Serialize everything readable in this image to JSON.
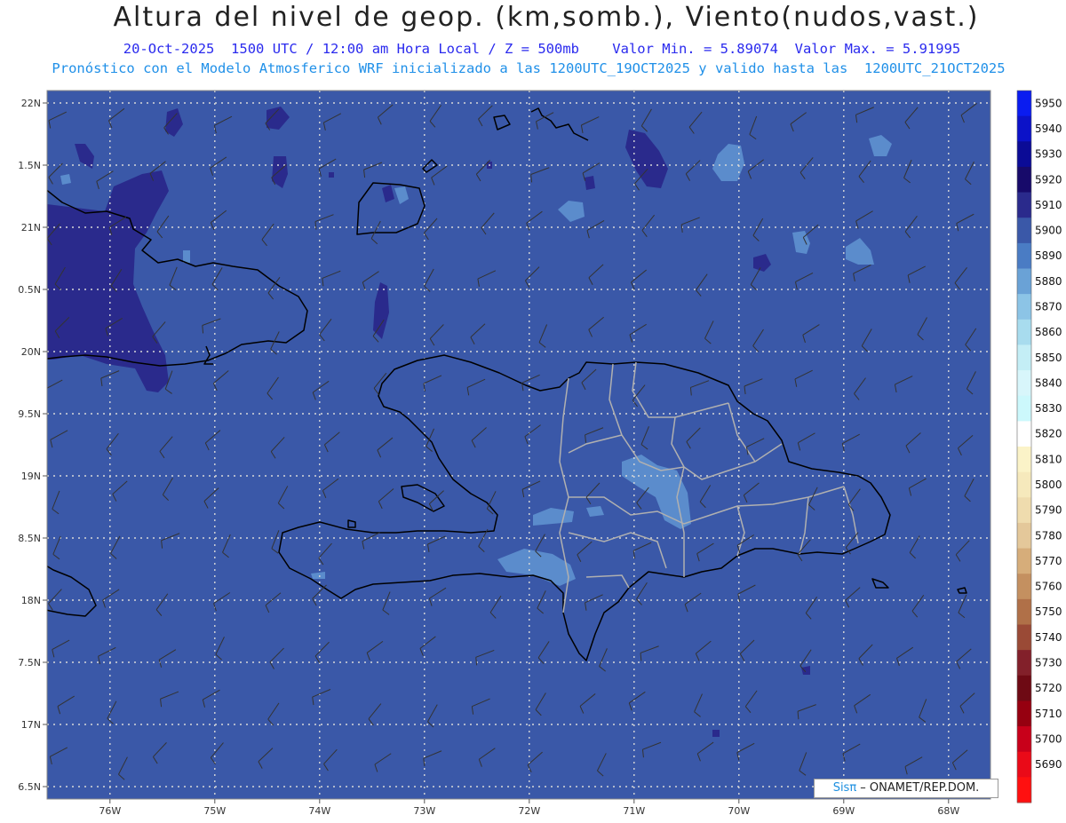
{
  "header": {
    "title": "Altura del nivel de geop. (km,somb.), Viento(nudos,vast.)",
    "line1": "20-Oct-2025  1500 UTC / 12:00 am Hora Local / Z = 500mb    Valor Min. = 5.89074  Valor Max. = 5.91995",
    "line2": "Pronóstico con el Modelo Atmosferico WRF inicializado a las 1200UTC_19OCT2025 y valido hasta las  1200UTC_21OCT2025"
  },
  "map": {
    "lon_range": [
      -76.6,
      -67.6
    ],
    "lat_range": [
      16.4,
      22.1
    ],
    "lon_ticks": [
      {
        "value": -76,
        "label": "76W"
      },
      {
        "value": -75,
        "label": "75W"
      },
      {
        "value": -74,
        "label": "74W"
      },
      {
        "value": -73,
        "label": "73W"
      },
      {
        "value": -72,
        "label": "72W"
      },
      {
        "value": -71,
        "label": "71W"
      },
      {
        "value": -70,
        "label": "70W"
      },
      {
        "value": -69,
        "label": "69W"
      },
      {
        "value": -68,
        "label": "68W"
      }
    ],
    "lat_ticks": [
      {
        "value": 22,
        "label": "22N"
      },
      {
        "value": 21.5,
        "label": "1.5N"
      },
      {
        "value": 21,
        "label": "21N"
      },
      {
        "value": 20.5,
        "label": "0.5N"
      },
      {
        "value": 20,
        "label": "20N"
      },
      {
        "value": 19.5,
        "label": "9.5N"
      },
      {
        "value": 19,
        "label": "19N"
      },
      {
        "value": 18.5,
        "label": "8.5N"
      },
      {
        "value": 18,
        "label": "18N"
      },
      {
        "value": 17.5,
        "label": "7.5N"
      },
      {
        "value": 17,
        "label": "17N"
      },
      {
        "value": 16.5,
        "label": "6.5N"
      }
    ],
    "background_color": "#3a58a8",
    "high_color": "#2a2a8c",
    "low_color": "#5b8ccc"
  },
  "legend": {
    "levels": [
      {
        "label": "5950",
        "color": "#0a1cf0"
      },
      {
        "label": "5940",
        "color": "#0c12c8"
      },
      {
        "label": "5930",
        "color": "#0b0b96"
      },
      {
        "label": "5920",
        "color": "#170a6a"
      },
      {
        "label": "5910",
        "color": "#2a2a8c"
      },
      {
        "label": "5900",
        "color": "#3a58a8"
      },
      {
        "label": "5890",
        "color": "#4a7cc4"
      },
      {
        "label": "5880",
        "color": "#6aa2d6"
      },
      {
        "label": "5870",
        "color": "#8cc4e6"
      },
      {
        "label": "5860",
        "color": "#a8dcee"
      },
      {
        "label": "5850",
        "color": "#c4eef6"
      },
      {
        "label": "5840",
        "color": "#d8f6fb"
      },
      {
        "label": "5830",
        "color": "#ccf8fc"
      },
      {
        "label": "5820",
        "color": "#ffffff"
      },
      {
        "label": "5810",
        "color": "#fbf3c8"
      },
      {
        "label": "5800",
        "color": "#f6e9bc"
      },
      {
        "label": "5790",
        "color": "#efdcae"
      },
      {
        "label": "5780",
        "color": "#e4c89a"
      },
      {
        "label": "5770",
        "color": "#d6ad7a"
      },
      {
        "label": "5760",
        "color": "#c49060"
      },
      {
        "label": "5750",
        "color": "#b07048"
      },
      {
        "label": "5740",
        "color": "#9a4a36"
      },
      {
        "label": "5730",
        "color": "#82202a"
      },
      {
        "label": "5720",
        "color": "#6e0a14"
      },
      {
        "label": "5710",
        "color": "#960010"
      },
      {
        "label": "5700",
        "color": "#c8001a"
      },
      {
        "label": "5690",
        "color": "#ea0a18"
      },
      {
        "label": "",
        "color": "#ff1010"
      }
    ]
  },
  "credit": {
    "logo": "Sisπ",
    "text": " – ONAMET/REP.DOM."
  }
}
